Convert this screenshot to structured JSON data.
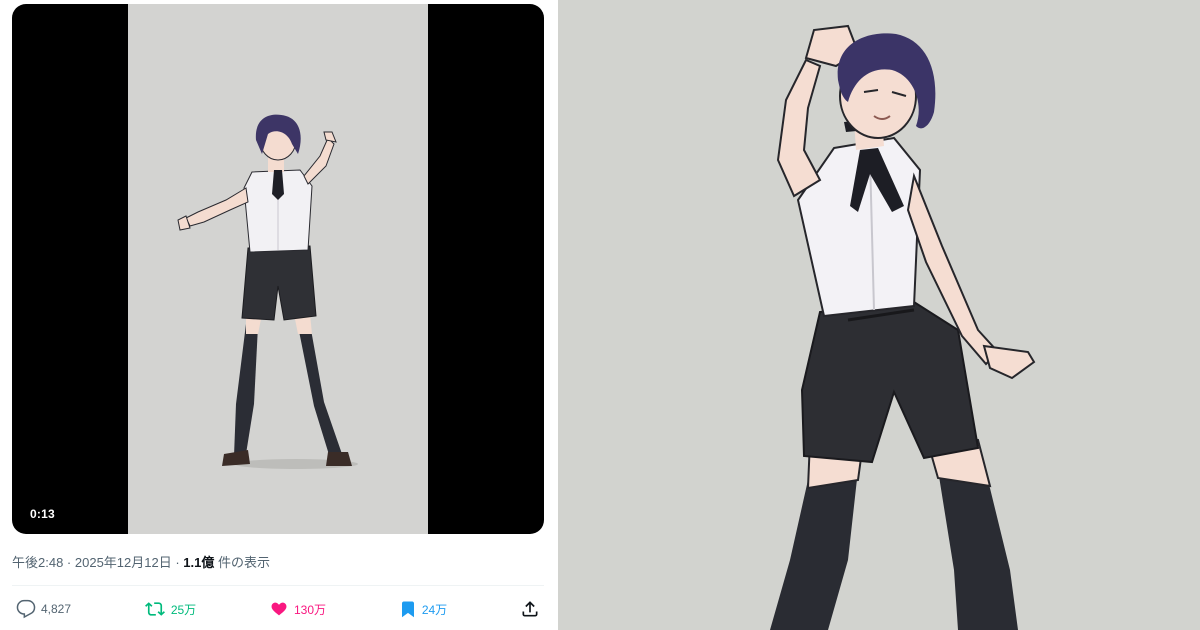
{
  "video": {
    "timestamp": "0:13"
  },
  "meta": {
    "time": "午後2:48",
    "sep1": " · ",
    "date": "2025年12月12日",
    "sep2": " · ",
    "views_count": "1.1億",
    "views_label": " 件の表示"
  },
  "actions": {
    "replies": "4,827",
    "reposts": "25万",
    "likes": "130万",
    "bookmarks": "24万"
  },
  "icons": {
    "reply": "reply-bubble-icon",
    "repost": "repost-arrows-icon",
    "like": "heart-icon",
    "bookmark": "bookmark-icon",
    "share": "share-upload-icon"
  },
  "colors": {
    "repost": "#00ba7c",
    "like": "#f91880",
    "bookmark": "#1d9bf0",
    "muted": "#536471",
    "video_bg": "#d3d3d1"
  }
}
